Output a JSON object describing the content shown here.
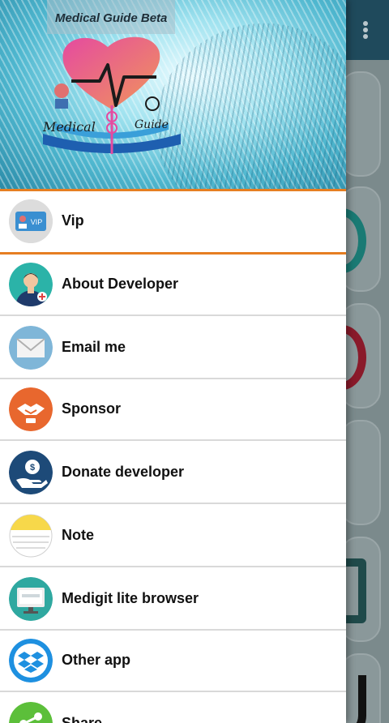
{
  "app": {
    "title": "Medical Guide Beta",
    "logo_text_left": "Medical",
    "logo_text_right": "Guide"
  },
  "drawer": {
    "vip": {
      "label": "Vip",
      "badge": "VIP",
      "icon": "vip-card-icon"
    },
    "items": [
      {
        "label": "About Developer",
        "icon": "developer-avatar-icon"
      },
      {
        "label": "Email me",
        "icon": "envelope-icon"
      },
      {
        "label": "Sponsor",
        "icon": "handshake-icon"
      },
      {
        "label": "Donate developer",
        "icon": "donate-hand-icon"
      },
      {
        "label": "Note",
        "icon": "notepad-icon"
      },
      {
        "label": "Medigit lite browser",
        "icon": "computer-monitor-icon"
      },
      {
        "label": "Other app",
        "icon": "dropbox-icon"
      },
      {
        "label": "Share",
        "icon": "share-icon"
      }
    ]
  },
  "colors": {
    "accent_divider": "#e67e22",
    "topbar": "#1f4a5c"
  }
}
